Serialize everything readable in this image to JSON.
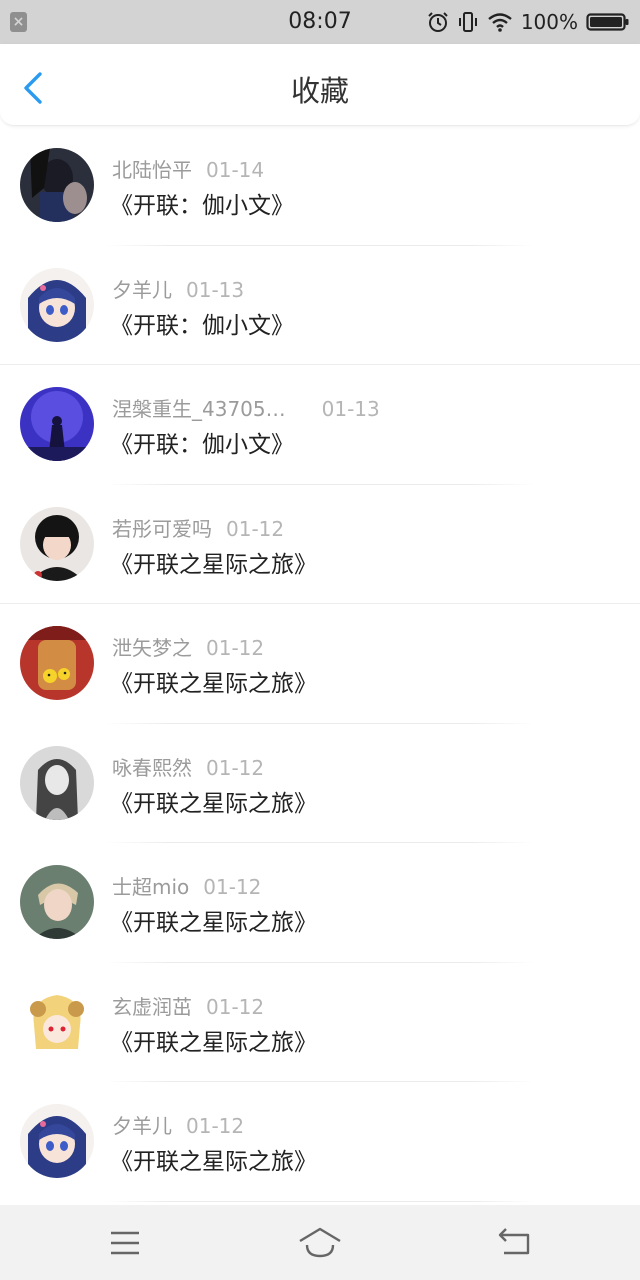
{
  "status_bar": {
    "time": "08:07",
    "battery_percent": "100%",
    "icons": [
      "notification-x-icon",
      "alarm-icon",
      "vibrate-icon",
      "wifi-icon",
      "battery-icon"
    ]
  },
  "nav": {
    "title": "收藏",
    "back_icon": "chevron-left-icon",
    "accent_color": "#2a9bf0"
  },
  "items": [
    {
      "name": "北陆怡平",
      "date": "01-14",
      "title": "《开联：伽小文》",
      "avatar": "dark-portrait"
    },
    {
      "name": "夕羊儿",
      "date": "01-13",
      "title": "《开联：伽小文》",
      "avatar": "anime-girl-blue-hair"
    },
    {
      "name": "涅槃重生_43705…",
      "date": "01-13",
      "title": "《开联：伽小文》",
      "avatar": "blue-purple-scene"
    },
    {
      "name": "若彤可爱吗",
      "date": "01-12",
      "title": "《开联之星际之旅》",
      "avatar": "child-photo"
    },
    {
      "name": "泄矢梦之",
      "date": "01-12",
      "title": "《开联之星际之旅》",
      "avatar": "jar-with-chicks"
    },
    {
      "name": "咏春熙然",
      "date": "01-12",
      "title": "《开联之星际之旅》",
      "avatar": "grayscale-woman"
    },
    {
      "name": "士超mio",
      "date": "01-12",
      "title": "《开联之星际之旅》",
      "avatar": "young-man-photo"
    },
    {
      "name": "玄虚润茁",
      "date": "01-12",
      "title": "《开联之星际之旅》",
      "avatar": "anime-horned-girl"
    },
    {
      "name": "夕羊儿",
      "date": "01-12",
      "title": "《开联之星际之旅》",
      "avatar": "anime-girl-blue-hair"
    }
  ],
  "bottom_bar": {
    "icons": [
      "menu-icon",
      "home-icon",
      "back-icon"
    ]
  }
}
